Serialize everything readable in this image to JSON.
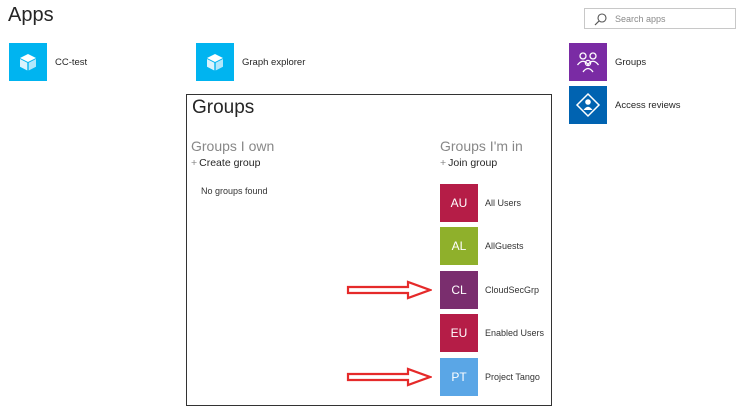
{
  "page": {
    "title": "Apps"
  },
  "search": {
    "placeholder": "Search apps"
  },
  "apps": [
    {
      "label": "CC-test",
      "icon": "cube-icon",
      "color": "#00b4f0"
    },
    {
      "label": "Graph explorer",
      "icon": "cube-icon",
      "color": "#00b4f0"
    },
    {
      "label": "Groups",
      "icon": "people-icon",
      "color": "#7a2ba4"
    },
    {
      "label": "Access reviews",
      "icon": "access-review-icon",
      "color": "#0063b1"
    }
  ],
  "groups_panel": {
    "title": "Groups",
    "owned": {
      "title": "Groups I own",
      "action": "Create group",
      "empty": "No groups found"
    },
    "member": {
      "title": "Groups I'm in",
      "action": "Join group",
      "groups": [
        {
          "initials": "AU",
          "name": "All Users",
          "color": "#b51d47"
        },
        {
          "initials": "AL",
          "name": "AllGuests",
          "color": "#8fb02b"
        },
        {
          "initials": "CL",
          "name": "CloudSecGrp",
          "color": "#7a2e6e"
        },
        {
          "initials": "EU",
          "name": "Enabled Users",
          "color": "#b51d47"
        },
        {
          "initials": "PT",
          "name": "Project Tango",
          "color": "#5aa6e6"
        }
      ]
    }
  },
  "annotation_color": "#e52a2a"
}
